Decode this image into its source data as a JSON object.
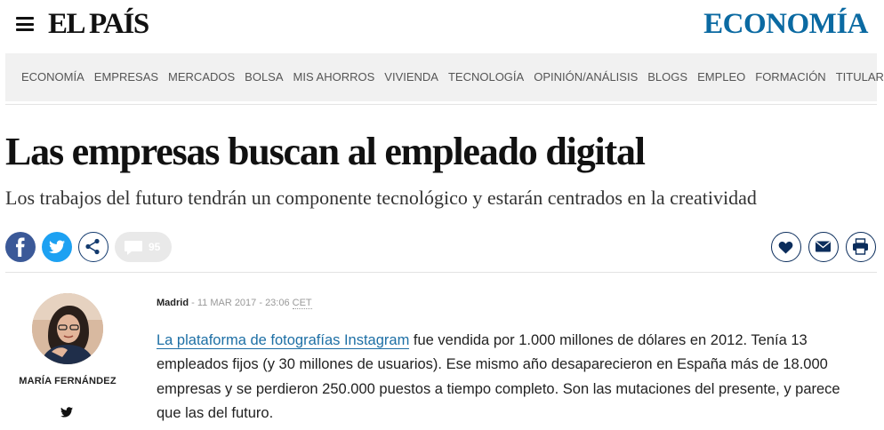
{
  "header": {
    "logo": "EL PAÍS",
    "section": "ECONOMÍA"
  },
  "nav": {
    "items": [
      "ECONOMÍA",
      "EMPRESAS",
      "MERCADOS",
      "BOLSA",
      "MIS AHORROS",
      "VIVIENDA",
      "TECNOLOGÍA",
      "OPINIÓN/ANÁLISIS",
      "BLOGS",
      "EMPLEO",
      "FORMACIÓN",
      "TITULARES »"
    ]
  },
  "article": {
    "headline": "Las empresas buscan al empleado digital",
    "subtitle": "Los trabajos del futuro tendrán un componente tecnológico y estarán centrados en la creatividad",
    "comments_count": "95",
    "author": "MARÍA FERNÁNDEZ",
    "city": "Madrid",
    "date_sep": " - ",
    "date": "11 MAR 2017 - 23:06 ",
    "timezone": "CET",
    "link_text": "La plataforma de fotografías Instagram",
    "body_rest": " fue vendida por 1.000 millones de dólares en 2012. Tenía 13 empleados fijos (y 30 millones de usuarios). Ese mismo año desaparecieron en España más de 18.000 empresas y se perdieron 250.000 puestos a tiempo completo. Son las mutaciones del presente, y parece que las del futuro."
  },
  "icons": {
    "menu": "hamburger-icon",
    "facebook": "facebook-icon",
    "twitter": "twitter-icon",
    "share": "share-icon",
    "comments": "comment-icon",
    "favorite": "heart-icon",
    "email": "mail-icon",
    "print": "print-icon",
    "author_twitter": "twitter-icon"
  },
  "colors": {
    "section_blue": "#0b6aa2",
    "facebook": "#3b5998",
    "twitter": "#1da1f2",
    "link": "#1d6fa5"
  }
}
